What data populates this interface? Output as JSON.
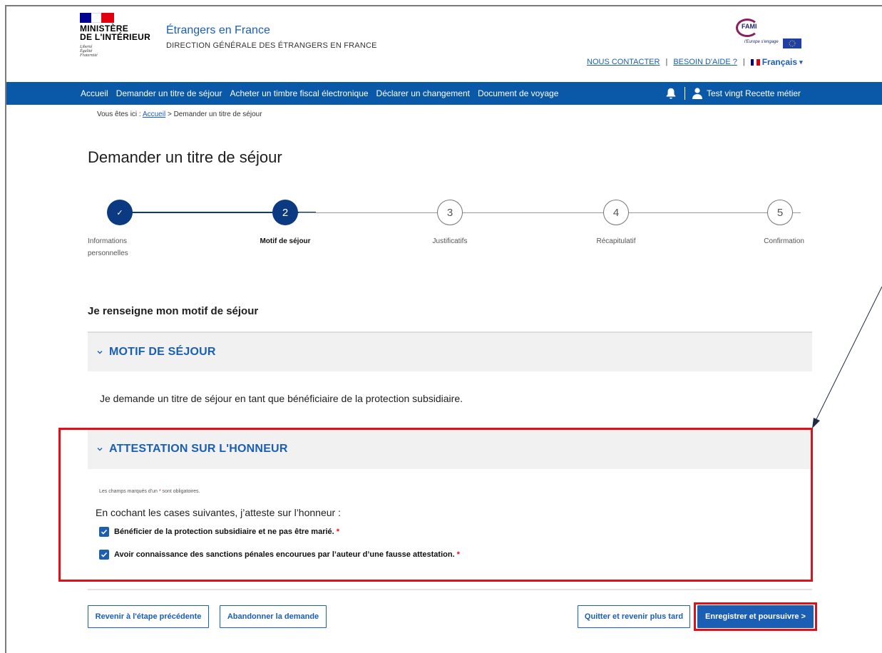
{
  "header": {
    "ministry_line1": "MINISTÈRE",
    "ministry_line2": "DE L'INTÉRIEUR",
    "devise_line1": "Liberté",
    "devise_line2": "Égalité",
    "devise_line3": "Fraternité",
    "site_title": "Étrangers en France",
    "site_subtitle": "DIRECTION GÉNÉRALE DES ÉTRANGERS EN FRANCE",
    "fami_logo": "FAMI",
    "fami_tagline": "l'Europe s'engage",
    "contact_link": "NOUS CONTACTER",
    "help_link": "BESOIN D'AIDE ?",
    "separator": "|",
    "language": "Français",
    "language_caret": "▾"
  },
  "nav": {
    "items": [
      "Accueil",
      "Demander un titre de séjour",
      "Acheter un timbre fiscal électronique",
      "Déclarer un changement",
      "Document de voyage"
    ],
    "user_name": "Test vingt Recette métier"
  },
  "breadcrumb": {
    "prefix": "Vous êtes ici :",
    "home": "Accueil",
    "current": "> Demander un titre de séjour"
  },
  "page_title": "Demander un titre de séjour",
  "stepper": {
    "steps": [
      {
        "number": "✓",
        "label_line1": "Informations",
        "label_line2": "personnelles",
        "state": "done"
      },
      {
        "number": "2",
        "label_line1": "Motif de séjour",
        "label_line2": "",
        "state": "current"
      },
      {
        "number": "3",
        "label_line1": "Justificatifs",
        "label_line2": "",
        "state": "todo"
      },
      {
        "number": "4",
        "label_line1": "Récapitulatif",
        "label_line2": "",
        "state": "todo"
      },
      {
        "number": "5",
        "label_line1": "Confirmation",
        "label_line2": "",
        "state": "todo"
      }
    ]
  },
  "section_title": "Je renseigne mon motif de séjour",
  "motif_panel": {
    "title": "MOTIF DE SÉJOUR",
    "text": "Je demande un titre de séjour en tant que bénéficiaire de la protection subsidiaire."
  },
  "attestation_panel": {
    "title": "ATTESTATION SUR L'HONNEUR",
    "required_note_before": "Les champs marqués d'un",
    "required_star": "*",
    "required_note_after": "sont obligatoires.",
    "intro": "En cochant les cases suivantes, j’atteste sur l’honneur :",
    "checkboxes": [
      {
        "label": "Bénéficier de la protection subsidiaire et ne pas être marié.",
        "checked": true
      },
      {
        "label": "Avoir connaissance des sanctions pénales encourues par l’auteur d’une fausse attestation.",
        "checked": true
      }
    ]
  },
  "buttons": {
    "previous": "Revenir à l'étape précédente",
    "abandon": "Abandonner la demande",
    "quit": "Quitter et revenir plus tard",
    "save_continue": "Enregistrer et poursuivre >"
  },
  "colors": {
    "primary_blue": "#1a5fb4",
    "nav_blue": "#0a58a8",
    "step_dark_blue": "#0b3a82",
    "highlight_red": "#e0101a"
  }
}
